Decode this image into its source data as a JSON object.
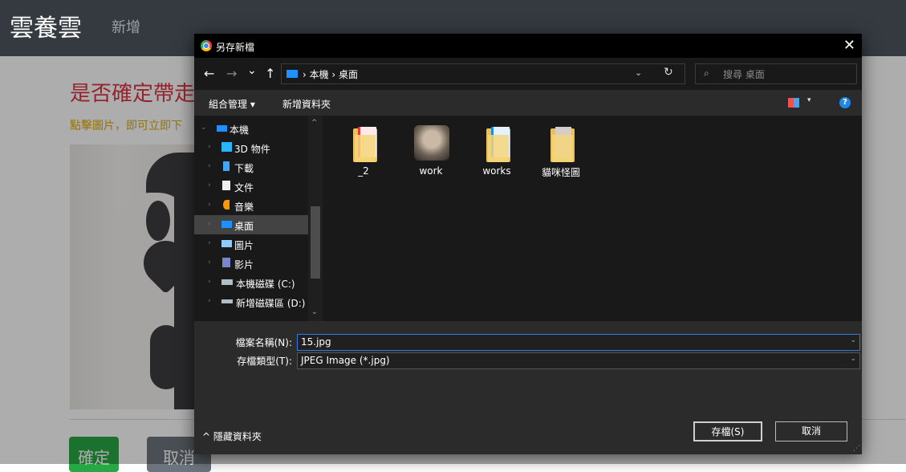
{
  "page": {
    "brand": "雲養雲",
    "nav_new": "新增",
    "question": "是否確定帶走",
    "hint": "點擊圖片，即可立即下",
    "confirm_label": "確定",
    "cancel_label": "取消"
  },
  "dialog": {
    "title": "另存新檔",
    "close": "✕",
    "nav": {
      "back": "←",
      "forward": "→",
      "recent": "⌄",
      "up": "↑"
    },
    "address": {
      "breadcrumb": "› 本機 › 桌面",
      "dropdown": "⌄",
      "refresh": "↻"
    },
    "search": {
      "placeholder": "搜尋 桌面",
      "icon": "⌕"
    },
    "toolbar": {
      "organize": "組合管理 ▾",
      "new_folder": "新增資料夾",
      "view_dropdown": "▾",
      "help": "?"
    },
    "sidebar": [
      {
        "label": "本機",
        "icon": "pc-icon",
        "color": "#1e90ff"
      },
      {
        "label": "3D 物件",
        "icon": "3d-objects-icon",
        "color": "#29b6f6"
      },
      {
        "label": "下載",
        "icon": "download-icon",
        "color": "#42a5f5"
      },
      {
        "label": "文件",
        "icon": "documents-icon",
        "color": "#eeeeee"
      },
      {
        "label": "音樂",
        "icon": "music-icon",
        "color": "#ff9800"
      },
      {
        "label": "桌面",
        "icon": "desktop-icon",
        "color": "#1e90ff",
        "selected": true
      },
      {
        "label": "圖片",
        "icon": "pictures-icon",
        "color": "#90caf9"
      },
      {
        "label": "影片",
        "icon": "videos-icon",
        "color": "#7986cb"
      },
      {
        "label": "本機磁碟 (C:)",
        "icon": "drive-c-icon",
        "color": "#b0bec5"
      },
      {
        "label": "新增磁碟區 (D:)",
        "icon": "drive-d-icon",
        "color": "#b0bec5"
      }
    ],
    "files": [
      {
        "label": "_2",
        "icon": "folder-pdf-icon"
      },
      {
        "label": "work",
        "icon": "cat-image-icon"
      },
      {
        "label": "works",
        "icon": "folder-doc-icon"
      },
      {
        "label": "貓咪怪圖",
        "icon": "folder-photo-icon"
      }
    ],
    "form": {
      "filename_label": "檔案名稱(N):",
      "filename_value": "15.jpg",
      "filetype_label": "存檔類型(T):",
      "filetype_value": "JPEG Image (*.jpg)",
      "hide_folders": "^ 隱藏資料夾",
      "save_label": "存檔(S)",
      "cancel_label": "取消"
    }
  }
}
